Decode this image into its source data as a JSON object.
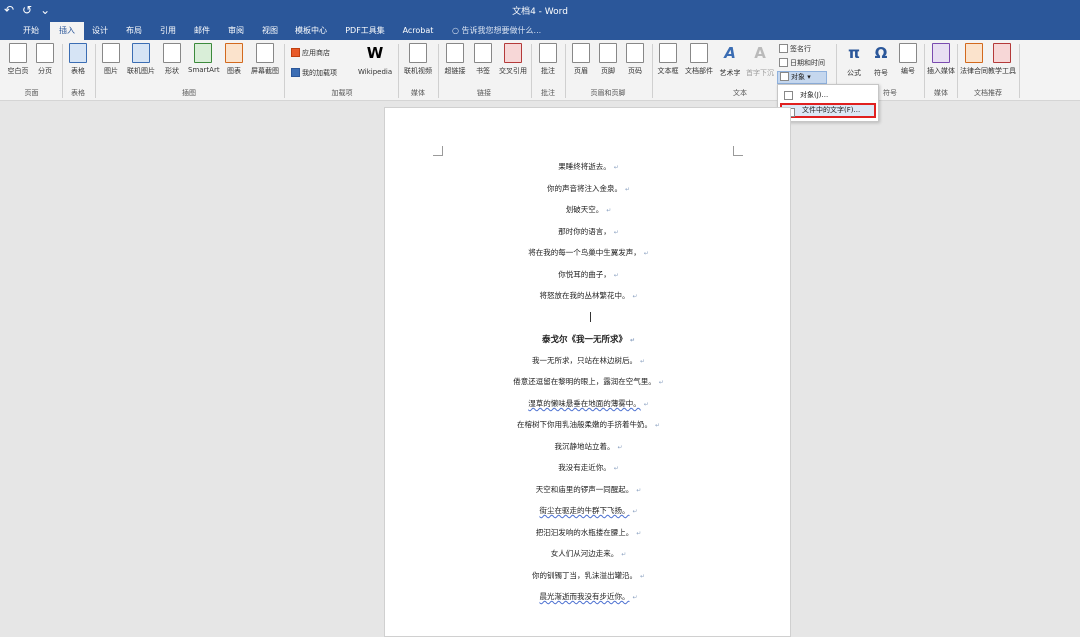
{
  "title": "文档4 - Word",
  "quick_access": {
    "undo": "↶",
    "redo": "↺",
    "more": "⌄"
  },
  "tabs": [
    "开始",
    "插入",
    "设计",
    "布局",
    "引用",
    "邮件",
    "审阅",
    "视图",
    "模板中心",
    "PDF工具集",
    "Acrobat"
  ],
  "active_tab": "插入",
  "search_placeholder": "告诉我您想要做什么...",
  "ribbon": {
    "page_group": {
      "label": "页面",
      "cover": "空白页",
      "break": "分页"
    },
    "table_group": {
      "label": "表格",
      "table": "表格"
    },
    "illustrations": {
      "label": "插图",
      "picture": "图片",
      "online_picture": "联机图片",
      "shapes": "形状",
      "smartart": "SmartArt",
      "chart": "图表",
      "screenshot": "屏幕截图"
    },
    "addins": {
      "label": "加载项",
      "store": "应用商店",
      "my_addins": "我的加载项",
      "wikipedia": "Wikipedia"
    },
    "media": {
      "label": "媒体",
      "online_video": "联机视频"
    },
    "links": {
      "label": "链接",
      "hyperlink": "超链接",
      "bookmark": "书签",
      "crossref": "交叉引用"
    },
    "comments": {
      "label": "批注",
      "comment": "批注"
    },
    "header_footer": {
      "label": "页眉和页脚",
      "header": "页眉",
      "footer": "页脚",
      "page_number": "页码"
    },
    "text": {
      "label": "文本",
      "textbox": "文本框",
      "quickparts": "文档部件",
      "wordart": "艺术字",
      "dropcap": "首字下沉",
      "signature": "签名行",
      "datetime": "日期和时间",
      "object": "对象"
    },
    "symbols": {
      "label": "符号",
      "equation": "公式",
      "symbol": "符号",
      "number": "编号"
    },
    "media2": {
      "label": "媒体",
      "insert_media": "插入媒体"
    },
    "doc_recommend": {
      "label": "文档推荐",
      "legal": "法律合同",
      "teaching": "教学工具"
    }
  },
  "object_dropdown": {
    "item1": "对象(J)...",
    "item2": "文件中的文字(F)..."
  },
  "document": {
    "lines": [
      "果睡终将逝去。",
      "你的声音将注入金泉。",
      "划破天空。",
      "那时你的语言，",
      "将在我的每一个鸟巢中生翼发声，",
      "你悦耳的曲子，",
      "将怒放在我的丛林繁花中。"
    ],
    "heading": "泰戈尔《我一无所求》",
    "poem": [
      "我一无所求，只站在林边树后。",
      "倦意还逗留在黎明的眼上，露润在空气里。",
      "湿草的懒味悬垂在地面的薄雾中。",
      "在榕树下你用乳油般柔嫩的手挤着牛奶。",
      "我沉静地站立着。",
      "我没有走近你。",
      "天空和庙里的锣声一同醒起。",
      "街尘在驱走的牛群下飞扬。",
      "把汩汩发响的水瓶搂在腰上。",
      "女人们从河边走来。",
      "你的钏镯丁当，乳沫溢出罐沿。",
      "晨光渐逝而我没有步近你。"
    ]
  }
}
